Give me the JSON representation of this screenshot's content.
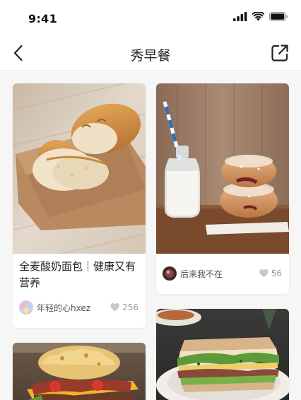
{
  "status": {
    "time": "9:41",
    "icons": [
      "signal-icon",
      "wifi-icon",
      "battery-icon"
    ]
  },
  "nav": {
    "title": "秀早餐",
    "back_icon": "chevron-left-icon",
    "share_icon": "share-icon"
  },
  "cards": [
    {
      "title": "全麦酸奶面包｜健康又有营养",
      "author": "年轻的心hxez",
      "likes": "256",
      "image": "bread-photo"
    },
    {
      "title": "",
      "author": "后来我不在",
      "likes": "56",
      "image": "milk-donut-photo"
    },
    {
      "title": "",
      "author": "",
      "likes": "",
      "image": "biscuit-sandwich-photo"
    },
    {
      "title": "",
      "author": "",
      "likes": "",
      "image": "club-sandwich-photo"
    }
  ],
  "colors": {
    "background": "#f6f6f6",
    "card": "#ffffff",
    "text": "#222222",
    "muted": "#9a9a9a"
  }
}
